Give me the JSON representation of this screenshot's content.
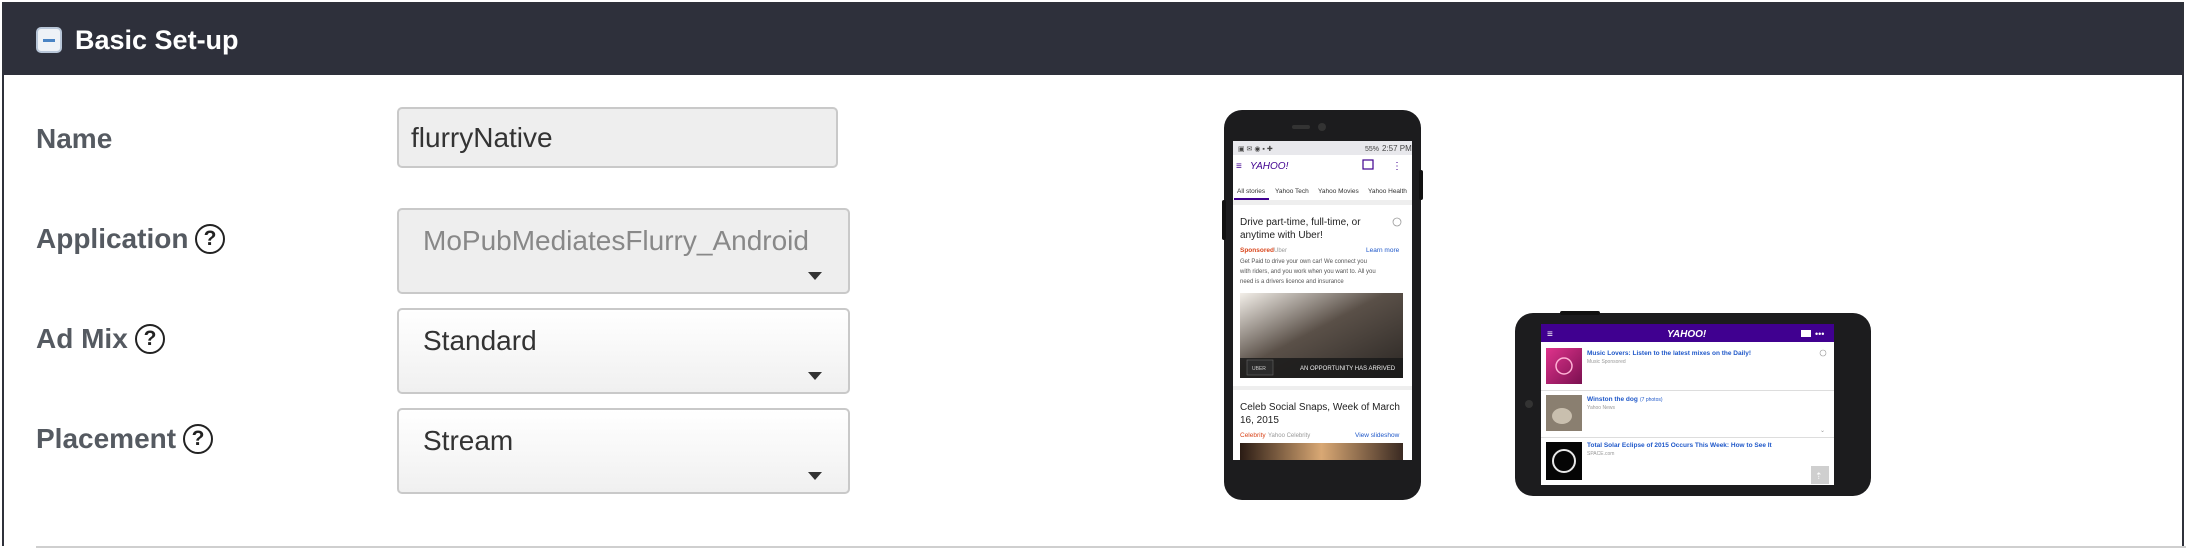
{
  "section": {
    "title": "Basic Set-up"
  },
  "form": {
    "name": {
      "label": "Name",
      "value": "flurryNative"
    },
    "application": {
      "label": "Application",
      "help": "?",
      "value": "MoPubMediatesFlurry_Android"
    },
    "ad_mix": {
      "label": "Ad Mix",
      "help": "?",
      "value": "Standard"
    },
    "placement": {
      "label": "Placement",
      "help": "?",
      "value": "Stream"
    }
  },
  "preview_portrait": {
    "status_time": "2:57 PM",
    "status_battery": "55%",
    "brand": "YAHOO!",
    "tabs": [
      "All stories",
      "Yahoo Tech",
      "Yahoo Movies",
      "Yahoo Health"
    ],
    "ad": {
      "headline": [
        "Drive part-time, full-time, or",
        "anytime with Uber!"
      ],
      "sponsored": "Sponsored",
      "sponsor_name": "Uber",
      "learn_more": "Learn more",
      "body": [
        "Get Paid to drive your own car! We connect you",
        "with riders, and you work when you want to. All you",
        "need is a drivers licence and insurance"
      ],
      "image_caption": "AN OPPORTUNITY HAS ARRIVED",
      "image_logo": "UBER"
    },
    "story": {
      "headline": [
        "Celeb Social Snaps, Week of March",
        "16, 2015"
      ],
      "category": "Celebrity",
      "source": "Yahoo Celebrity",
      "cta": "View slideshow"
    }
  },
  "preview_landscape": {
    "brand": "YAHOO!",
    "items": [
      {
        "title": "Music Lovers: Listen to the latest mixes on the Daily!",
        "meta": "Music  Sponsored"
      },
      {
        "title": "Winston the dog",
        "meta_link": "(7 photos)",
        "meta": "Yahoo News"
      },
      {
        "title": "Total Solar Eclipse of 2015 Occurs This Week: How to See It",
        "meta": "SPACE.com"
      }
    ]
  },
  "colors": {
    "header_bg": "#2e303b",
    "yahoo_purple": "#400090",
    "link_blue": "#1f58c9",
    "sponsored_orange": "#d9461c"
  }
}
